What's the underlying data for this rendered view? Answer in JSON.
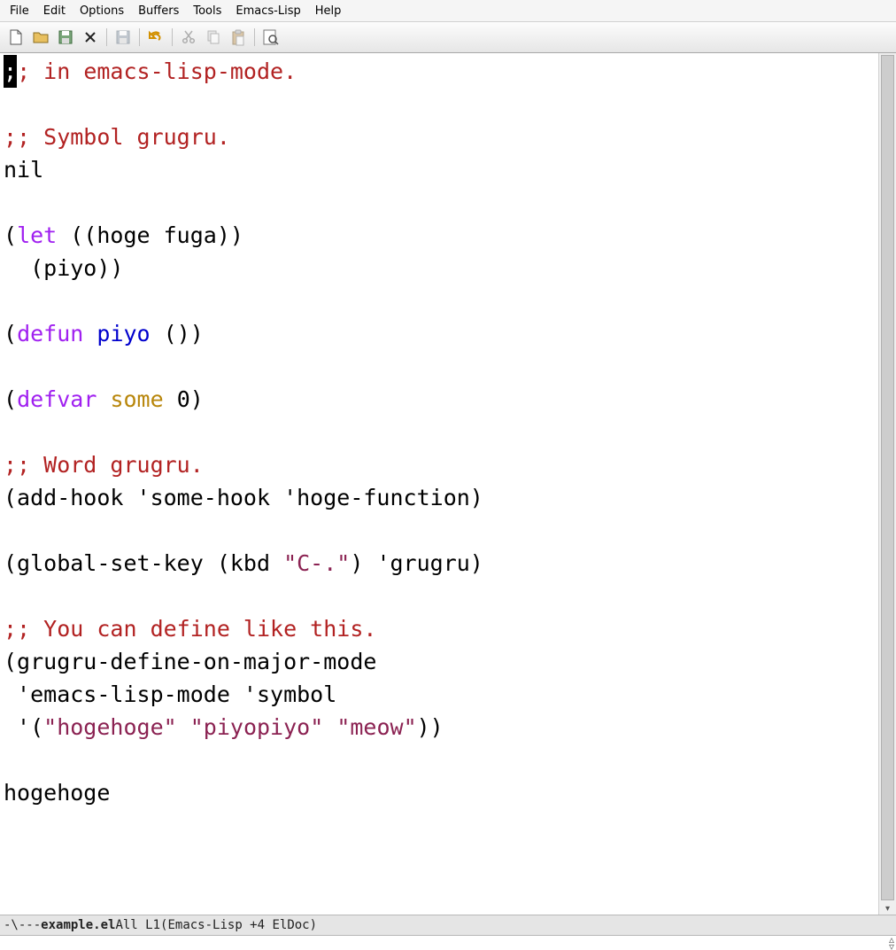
{
  "menu": [
    "File",
    "Edit",
    "Options",
    "Buffers",
    "Tools",
    "Emacs-Lisp",
    "Help"
  ],
  "toolbar_icons": [
    "new-file-icon",
    "open-folder-icon",
    "diskette-icon",
    "close-x-icon",
    "sep",
    "save-icon",
    "sep",
    "undo-icon",
    "sep",
    "cut-icon",
    "copy-icon",
    "paste-icon",
    "sep",
    "search-icon"
  ],
  "code": {
    "cursor_char": ";",
    "line1_rest": "; in emacs-lisp-mode.",
    "line2": "",
    "line3": ";; Symbol grugru.",
    "line4": "nil",
    "line5": "",
    "line6_a": "(",
    "line6_kw": "let",
    "line6_b": " ((hoge fuga))",
    "line7": "  (piyo))",
    "line8": "",
    "line9_a": "(",
    "line9_kw": "defun",
    "line9_sp": " ",
    "line9_fn": "piyo",
    "line9_b": " ())",
    "line10": "",
    "line11_a": "(",
    "line11_kw": "defvar",
    "line11_sp": " ",
    "line11_var": "some",
    "line11_b": " 0)",
    "line12": "",
    "line13": ";; Word grugru.",
    "line14": "(add-hook 'some-hook 'hoge-function)",
    "line15": "",
    "line16_a": "(global-set-key (kbd ",
    "line16_str": "\"C-.\"",
    "line16_b": ") 'grugru)",
    "line17": "",
    "line18": ";; You can define like this.",
    "line19": "(grugru-define-on-major-mode",
    "line20": " 'emacs-lisp-mode 'symbol",
    "line21_a": " '(",
    "line21_s1": "\"hogehoge\"",
    "line21_sp1": " ",
    "line21_s2": "\"piyopiyo\"",
    "line21_sp2": " ",
    "line21_s3": "\"meow\"",
    "line21_b": "))",
    "line22": "",
    "line23": "hogehoge"
  },
  "modeline": {
    "left": "-\\--- ",
    "buffer": "example.el",
    "mid": "   All L1     ",
    "mode": "(Emacs-Lisp +4 ElDoc)"
  }
}
